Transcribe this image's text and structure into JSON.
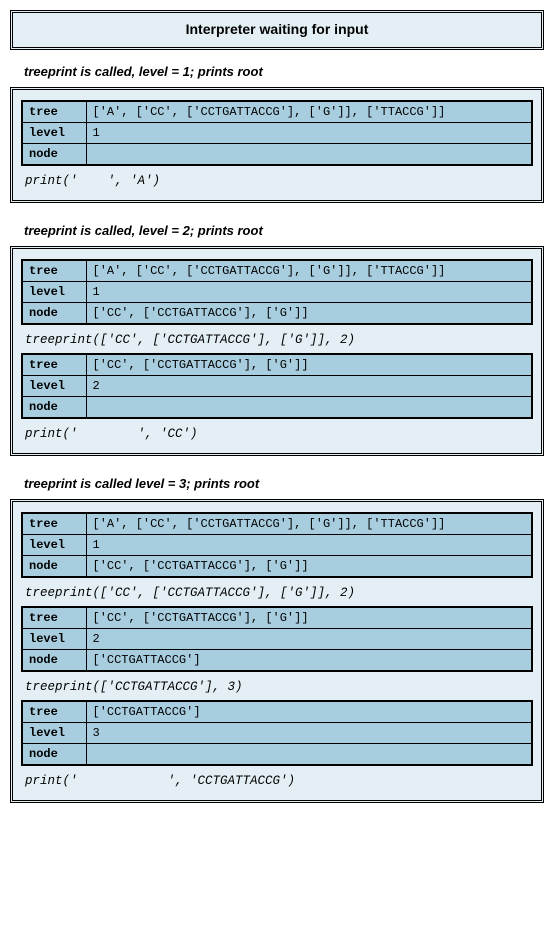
{
  "header": {
    "title": "Interpreter waiting for input"
  },
  "sections": [
    {
      "title": "treeprint is called, level = 1; prints root",
      "blocks": [
        {
          "rows": {
            "tree": "['A', ['CC', ['CCTGATTACCG'], ['G']], ['TTACCG']]",
            "level": "1",
            "node": ""
          },
          "code": "print('    ', 'A')"
        }
      ]
    },
    {
      "title": "treeprint is called, level = 2; prints root",
      "blocks": [
        {
          "rows": {
            "tree": "['A', ['CC', ['CCTGATTACCG'], ['G']], ['TTACCG']]",
            "level": "1",
            "node": "['CC', ['CCTGATTACCG'], ['G']]"
          },
          "code": "treeprint(['CC', ['CCTGATTACCG'], ['G']], 2)"
        },
        {
          "rows": {
            "tree": "['CC', ['CCTGATTACCG'], ['G']]",
            "level": "2",
            "node": ""
          },
          "code": "print('        ', 'CC')"
        }
      ]
    },
    {
      "title": "treeprint is called level = 3; prints root",
      "blocks": [
        {
          "rows": {
            "tree": "['A', ['CC', ['CCTGATTACCG'], ['G']], ['TTACCG']]",
            "level": "1",
            "node": "['CC', ['CCTGATTACCG'], ['G']]"
          },
          "code": "treeprint(['CC', ['CCTGATTACCG'], ['G']], 2)"
        },
        {
          "rows": {
            "tree": "['CC', ['CCTGATTACCG'], ['G']]",
            "level": "2",
            "node": "['CCTGATTACCG']"
          },
          "code": "treeprint(['CCTGATTACCG'], 3)"
        },
        {
          "rows": {
            "tree": "['CCTGATTACCG']",
            "level": "3",
            "node": ""
          },
          "code": "print('            ', 'CCTGATTACCG')"
        }
      ]
    }
  ],
  "labels": {
    "tree": "tree",
    "level": "level",
    "node": "node"
  }
}
